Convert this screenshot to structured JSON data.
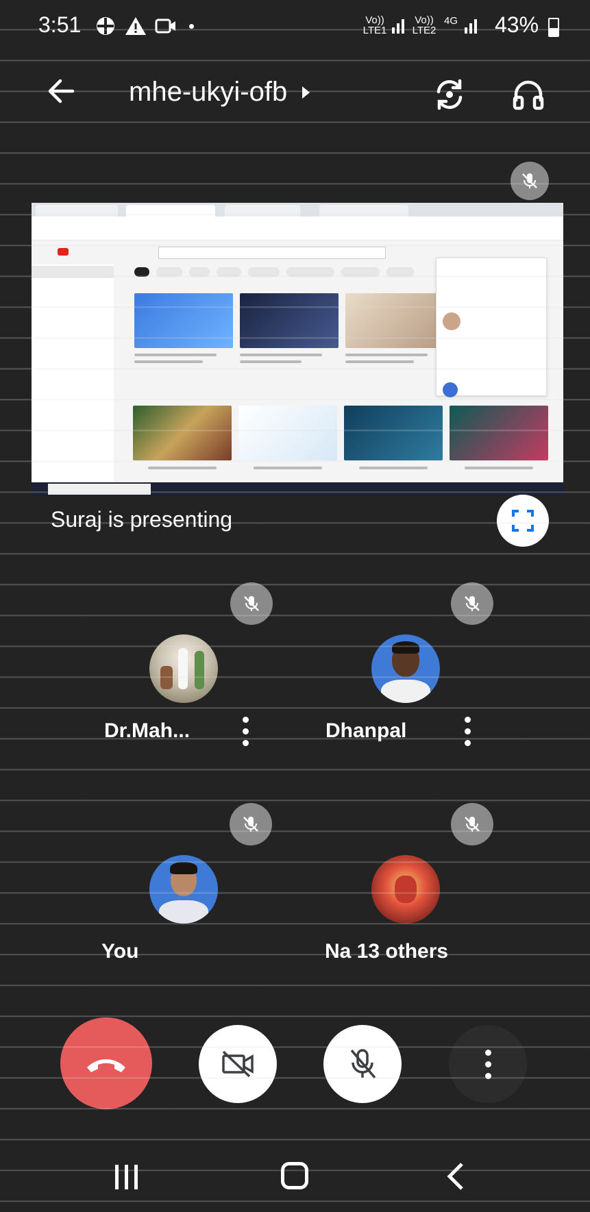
{
  "status_bar": {
    "time": "3:51",
    "network1": "Vo)) LTE1",
    "network2": "Vo)) LTE2",
    "network_type": "4G",
    "battery": "43%"
  },
  "top_bar": {
    "meeting_code": "mhe-ukyi-ofb"
  },
  "presentation": {
    "label": "Suraj is presenting"
  },
  "participants": [
    {
      "name": "Dr.Mah..."
    },
    {
      "name": "Dhanpal"
    },
    {
      "name": "You"
    },
    {
      "name": "Na 13 others"
    }
  ],
  "colors": {
    "background": "#232323",
    "end_call": "#e55b5b",
    "mute_badge": "#8a8a8a",
    "accent_blue": "#1a73e8"
  },
  "icons": [
    "back-arrow-icon",
    "chevron-right-icon",
    "switch-camera-icon",
    "headphones-icon",
    "mic-off-icon",
    "fullscreen-icon",
    "more-vert-icon",
    "end-call-icon",
    "video-off-icon"
  ]
}
